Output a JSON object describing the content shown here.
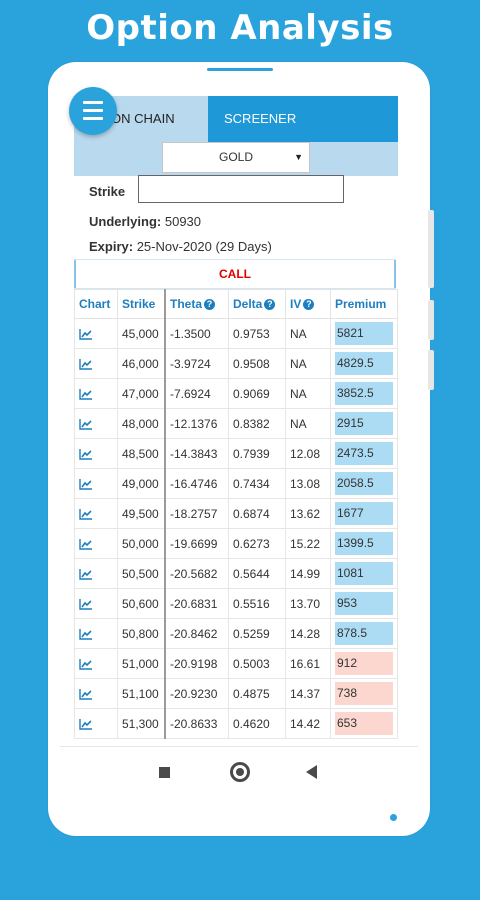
{
  "headline": "Option Analysis",
  "tabs": [
    {
      "label": "ION CHAIN",
      "active": true
    },
    {
      "label": "SCREENER",
      "active": false
    }
  ],
  "commodity_select": {
    "value": "GOLD",
    "arrow": "▼"
  },
  "strike": {
    "label": "Strike",
    "value": ""
  },
  "underlying": {
    "label": "Underlying:",
    "value": "50930"
  },
  "expiry": {
    "label": "Expiry:",
    "value": "25-Nov-2020 (29 Days)"
  },
  "call_label": "CALL",
  "table": {
    "headers": [
      "Chart",
      "Strike",
      "Theta",
      "Delta",
      "IV",
      "Premium"
    ],
    "help_glyph": "?",
    "rows": [
      {
        "strike": "45,000",
        "theta": "-1.3500",
        "delta": "0.9753",
        "iv": "NA",
        "premium": "5821",
        "tone": "blue"
      },
      {
        "strike": "46,000",
        "theta": "-3.9724",
        "delta": "0.9508",
        "iv": "NA",
        "premium": "4829.5",
        "tone": "blue"
      },
      {
        "strike": "47,000",
        "theta": "-7.6924",
        "delta": "0.9069",
        "iv": "NA",
        "premium": "3852.5",
        "tone": "blue"
      },
      {
        "strike": "48,000",
        "theta": "-12.1376",
        "delta": "0.8382",
        "iv": "NA",
        "premium": "2915",
        "tone": "blue"
      },
      {
        "strike": "48,500",
        "theta": "-14.3843",
        "delta": "0.7939",
        "iv": "12.08",
        "premium": "2473.5",
        "tone": "blue"
      },
      {
        "strike": "49,000",
        "theta": "-16.4746",
        "delta": "0.7434",
        "iv": "13.08",
        "premium": "2058.5",
        "tone": "blue"
      },
      {
        "strike": "49,500",
        "theta": "-18.2757",
        "delta": "0.6874",
        "iv": "13.62",
        "premium": "1677",
        "tone": "blue"
      },
      {
        "strike": "50,000",
        "theta": "-19.6699",
        "delta": "0.6273",
        "iv": "15.22",
        "premium": "1399.5",
        "tone": "blue"
      },
      {
        "strike": "50,500",
        "theta": "-20.5682",
        "delta": "0.5644",
        "iv": "14.99",
        "premium": "1081",
        "tone": "blue"
      },
      {
        "strike": "50,600",
        "theta": "-20.6831",
        "delta": "0.5516",
        "iv": "13.70",
        "premium": "953",
        "tone": "blue"
      },
      {
        "strike": "50,800",
        "theta": "-20.8462",
        "delta": "0.5259",
        "iv": "14.28",
        "premium": "878.5",
        "tone": "blue"
      },
      {
        "strike": "51,000",
        "theta": "-20.9198",
        "delta": "0.5003",
        "iv": "16.61",
        "premium": "912",
        "tone": "red"
      },
      {
        "strike": "51,100",
        "theta": "-20.9230",
        "delta": "0.4875",
        "iv": "14.37",
        "premium": "738",
        "tone": "red"
      },
      {
        "strike": "51,300",
        "theta": "-20.8633",
        "delta": "0.4620",
        "iv": "14.42",
        "premium": "653",
        "tone": "red"
      }
    ]
  },
  "icons": {
    "menu": "hamburger-icon",
    "chart": "line-chart-icon",
    "nav_recent": "square-icon",
    "nav_home": "circle-icon",
    "nav_back": "triangle-icon"
  },
  "colors": {
    "background": "#2aa3dc",
    "tab_active": "#b9d9ee",
    "tab_alt": "#1e98d6",
    "call_text": "#e00000",
    "premium_itm": "#acdcf4",
    "premium_otm": "#fcd7d0",
    "header_text": "#1e7fc0"
  }
}
